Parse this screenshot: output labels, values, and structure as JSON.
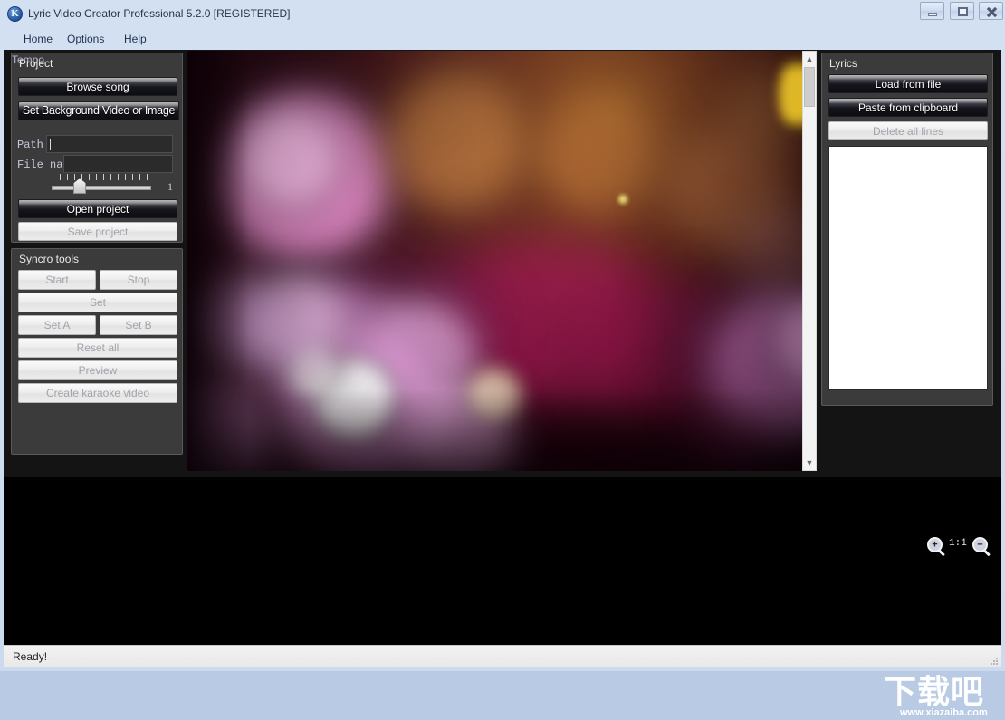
{
  "window": {
    "title": "Lyric Video Creator Professional 5.2.0 [REGISTERED]",
    "icon": "app-logo-icon",
    "controls": {
      "minimize": "minimize-icon",
      "maximize": "maximize-icon",
      "close": "close-icon"
    }
  },
  "menu": {
    "items": [
      {
        "label": "Home"
      },
      {
        "label": "Options"
      },
      {
        "label": "Help"
      }
    ]
  },
  "project_panel": {
    "legend": "Project",
    "browse_song": "Browse song",
    "set_background": "Set Background Video or Image",
    "path_label": "Path",
    "path_value": "",
    "filename_label": "File name",
    "filename_value": "",
    "tempo_label": "Tempo",
    "tempo_value": "1",
    "open_project": "Open project",
    "save_project": "Save project"
  },
  "syncro_panel": {
    "legend": "Syncro tools",
    "start": "Start",
    "stop": "Stop",
    "set": "Set",
    "set_a": "Set A",
    "set_b": "Set B",
    "reset_all": "Reset all",
    "preview": "Preview",
    "create_video": "Create karaoke video"
  },
  "lyrics_panel": {
    "legend": "Lyrics",
    "load_from_file": "Load from file",
    "paste_from_clipboard": "Paste from clipboard",
    "delete_all_lines": "Delete all lines",
    "lines": []
  },
  "preview": {
    "scrollbar": {
      "up": "▲",
      "down": "▼"
    }
  },
  "zoom_controls": {
    "zoom_in": "+",
    "zoom_out": "−",
    "ratio": "1:1"
  },
  "watermark": {
    "text": "下载吧",
    "url": "www.xiazaiba.com"
  },
  "statusbar": {
    "text": "Ready!"
  },
  "colors": {
    "titlebar": "#cfdcf0",
    "panel": "#3b3b3b",
    "client": "#141414",
    "button_dark": "#15151c",
    "button_disabled": "#ececec",
    "listbox": "#ffffff"
  }
}
